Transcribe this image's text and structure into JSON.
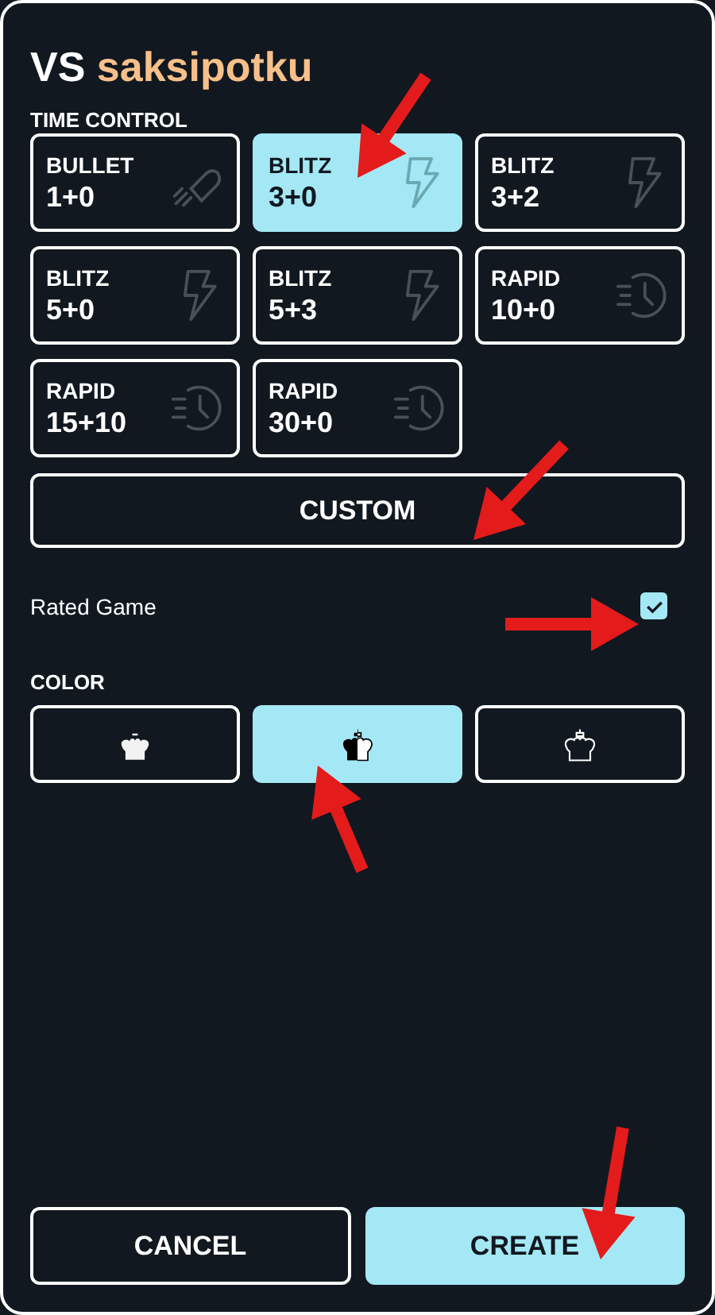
{
  "title": {
    "prefix": "VS",
    "opponent": "saksipotku"
  },
  "time_control": {
    "label": "TIME CONTROL",
    "options": [
      {
        "category": "BULLET",
        "time": "1+0",
        "kind": "rocket",
        "selected": false
      },
      {
        "category": "BLITZ",
        "time": "3+0",
        "kind": "bolt",
        "selected": true
      },
      {
        "category": "BLITZ",
        "time": "3+2",
        "kind": "bolt",
        "selected": false
      },
      {
        "category": "BLITZ",
        "time": "5+0",
        "kind": "bolt",
        "selected": false
      },
      {
        "category": "BLITZ",
        "time": "5+3",
        "kind": "bolt",
        "selected": false
      },
      {
        "category": "RAPID",
        "time": "10+0",
        "kind": "clock",
        "selected": false
      },
      {
        "category": "RAPID",
        "time": "15+10",
        "kind": "clock",
        "selected": false
      },
      {
        "category": "RAPID",
        "time": "30+0",
        "kind": "clock",
        "selected": false
      }
    ],
    "custom_button": "CUSTOM"
  },
  "rated_game": {
    "label": "Rated Game",
    "checked": true
  },
  "color": {
    "label": "COLOR",
    "options": [
      {
        "kind": "white",
        "selected": false
      },
      {
        "kind": "random",
        "selected": true
      },
      {
        "kind": "black",
        "selected": false
      }
    ]
  },
  "buttons": [
    {
      "label": "CANCEL",
      "kind": "secondary"
    },
    {
      "label": "CREATE",
      "kind": "primary"
    }
  ]
}
